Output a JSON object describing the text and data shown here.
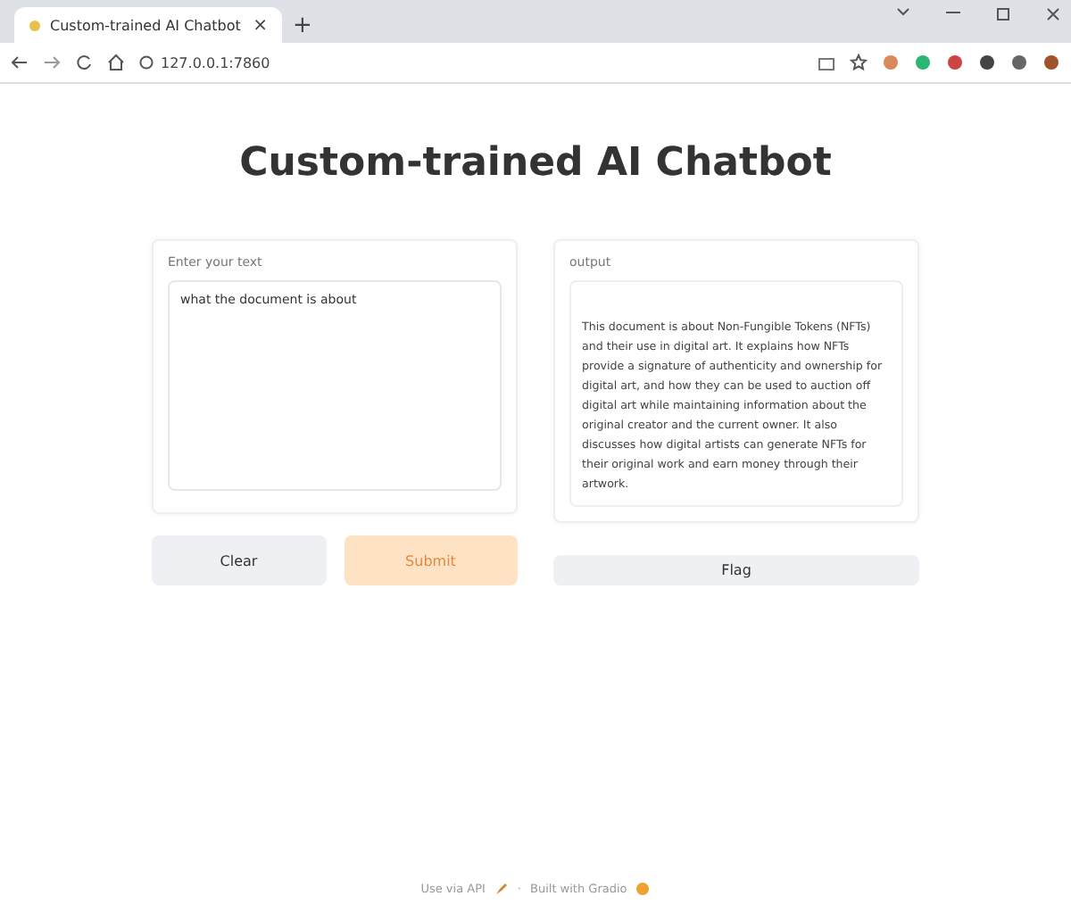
{
  "browser": {
    "tab_title": "Custom-trained AI Chatbot",
    "tab_close": "×",
    "new_tab": "+",
    "url": "127.0.0.1:7860"
  },
  "page": {
    "title": "Custom-trained AI Chatbot"
  },
  "input_panel": {
    "label": "Enter your text",
    "value": "what the document is about"
  },
  "buttons": [
    {
      "label": "Clear",
      "kind": "secondary"
    },
    {
      "label": "Submit",
      "kind": "primary"
    }
  ],
  "output_panel": {
    "label": "output",
    "text": "This document is about Non-Fungible Tokens (NFTs) and their use in digital art. It explains how NFTs provide a signature of authenticity and ownership for digital art, and how they can be used to auction off digital art while maintaining information about the original creator and the current owner. It also discusses how digital artists can generate NFTs for their original work and earn money through their artwork."
  },
  "flag_button": {
    "label": "Flag"
  },
  "footer": {
    "api_link": "Use via API",
    "separator": "·",
    "built_with": "Built with Gradio"
  }
}
